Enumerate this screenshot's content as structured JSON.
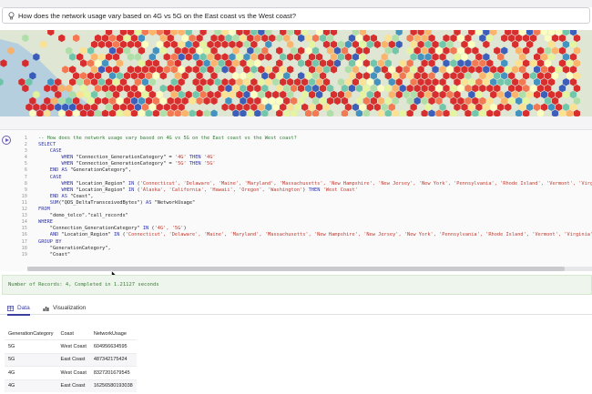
{
  "search": {
    "query": "How does the network usage vary based on 4G vs 5G on the East coast vs the West coast?"
  },
  "editor": {
    "lines": [
      {
        "n": "1",
        "parts": [
          {
            "c": "c",
            "t": "-- How does the network usage vary based on 4G vs 5G on the East coast vs the West coast?"
          }
        ]
      },
      {
        "n": "2",
        "parts": [
          {
            "c": "k",
            "t": "SELECT"
          }
        ]
      },
      {
        "n": "3",
        "parts": [
          {
            "c": "k",
            "t": "    CASE"
          }
        ]
      },
      {
        "n": "4",
        "parts": [
          {
            "c": "k",
            "t": "        WHEN "
          },
          {
            "c": "t",
            "t": "\"Connection_GenerationCategory\" = "
          },
          {
            "c": "s",
            "t": "'4G'"
          },
          {
            "c": "k",
            "t": " THEN "
          },
          {
            "c": "s",
            "t": "'4G'"
          }
        ]
      },
      {
        "n": "5",
        "parts": [
          {
            "c": "k",
            "t": "        WHEN "
          },
          {
            "c": "t",
            "t": "\"Connection_GenerationCategory\" = "
          },
          {
            "c": "s",
            "t": "'5G'"
          },
          {
            "c": "k",
            "t": " THEN "
          },
          {
            "c": "s",
            "t": "'5G'"
          }
        ]
      },
      {
        "n": "6",
        "parts": [
          {
            "c": "k",
            "t": "    END AS "
          },
          {
            "c": "t",
            "t": "\"GenerationCategory\","
          }
        ]
      },
      {
        "n": "7",
        "parts": [
          {
            "c": "k",
            "t": "    CASE"
          }
        ]
      },
      {
        "n": "8",
        "parts": [
          {
            "c": "k",
            "t": "        WHEN "
          },
          {
            "c": "t",
            "t": "\"Location_Region\" "
          },
          {
            "c": "k",
            "t": "IN "
          },
          {
            "c": "t",
            "t": "("
          },
          {
            "c": "s",
            "t": "'Connecticut', 'Delaware', 'Maine', 'Maryland', 'Massachusetts', 'New Hampshire', 'New Jersey', 'New York', 'Pennsylvania', 'Rhode Island', 'Vermont', 'Virginia', 'West"
          }
        ]
      },
      {
        "n": "9",
        "parts": [
          {
            "c": "k",
            "t": "        WHEN "
          },
          {
            "c": "t",
            "t": "\"Location_Region\" "
          },
          {
            "c": "k",
            "t": "IN "
          },
          {
            "c": "t",
            "t": "("
          },
          {
            "c": "s",
            "t": "'Alaska', 'California', 'Hawaii', 'Oregon', 'Washington'"
          },
          {
            "c": "t",
            "t": ") "
          },
          {
            "c": "k",
            "t": "THEN "
          },
          {
            "c": "s",
            "t": "'West Coast'"
          }
        ]
      },
      {
        "n": "10",
        "parts": [
          {
            "c": "k",
            "t": "    END AS "
          },
          {
            "c": "t",
            "t": "\"Coast\","
          }
        ]
      },
      {
        "n": "11",
        "parts": [
          {
            "c": "k",
            "t": "    SUM"
          },
          {
            "c": "t",
            "t": "(\"QOS_DeltaTransceivedBytes\") "
          },
          {
            "c": "k",
            "t": "AS "
          },
          {
            "c": "t",
            "t": "\"NetworkUsage\""
          }
        ]
      },
      {
        "n": "12",
        "parts": [
          {
            "c": "k",
            "t": "FROM"
          }
        ]
      },
      {
        "n": "13",
        "parts": [
          {
            "c": "t",
            "t": "    \"demo_telco\".\"call_records\""
          }
        ]
      },
      {
        "n": "14",
        "parts": [
          {
            "c": "k",
            "t": "WHERE"
          }
        ]
      },
      {
        "n": "15",
        "parts": [
          {
            "c": "t",
            "t": "    \"Connection_GenerationCategory\" "
          },
          {
            "c": "k",
            "t": "IN "
          },
          {
            "c": "t",
            "t": "("
          },
          {
            "c": "s",
            "t": "'4G', '5G'"
          },
          {
            "c": "t",
            "t": ")"
          }
        ]
      },
      {
        "n": "16",
        "parts": [
          {
            "c": "k",
            "t": "    AND "
          },
          {
            "c": "t",
            "t": "\"Location_Region\" "
          },
          {
            "c": "k",
            "t": "IN "
          },
          {
            "c": "t",
            "t": "("
          },
          {
            "c": "s",
            "t": "'Connecticut', 'Delaware', 'Maine', 'Maryland', 'Massachusetts', 'New Hampshire', 'New Jersey', 'New York', 'Pennsylvania', 'Rhode Island', 'Vermont', 'Virginia', 'West Virgi"
          }
        ]
      },
      {
        "n": "17",
        "parts": [
          {
            "c": "k",
            "t": "GROUP BY"
          }
        ]
      },
      {
        "n": "18",
        "parts": [
          {
            "c": "t",
            "t": "    \"GenerationCategory\","
          }
        ]
      },
      {
        "n": "19",
        "parts": [
          {
            "c": "t",
            "t": "    \"Coast\""
          }
        ]
      }
    ]
  },
  "status": {
    "message": "Number of Records: 4, Completed in 1.21127 seconds"
  },
  "tabs": [
    {
      "label": "Data",
      "icon": "table-icon",
      "active": true
    },
    {
      "label": "Visualization",
      "icon": "bar-chart-icon",
      "active": false
    }
  ],
  "results": {
    "columns": [
      "GenerationCategory",
      "Coast",
      "NetworkUsage"
    ],
    "rows": [
      [
        "5G",
        "West Coast",
        "604956634595"
      ],
      [
        "5G",
        "East Coast",
        "487342175424"
      ],
      [
        "4G",
        "West Coast",
        "8327201679545"
      ],
      [
        "4G",
        "East Coast",
        "16256580193038"
      ]
    ]
  },
  "colors": {
    "accent": "#3a3f9e",
    "keyword": "#2f35a8",
    "string": "#c0392b",
    "comment": "#2e7d32",
    "status_text": "#3e7c3a",
    "hex_palette": [
      "#d7191c",
      "#f46d43",
      "#fdae61",
      "#fee08b",
      "#ffffbf",
      "#e6f598",
      "#abdda4",
      "#66c2a5",
      "#3288bd",
      "#2b4fb6"
    ]
  }
}
